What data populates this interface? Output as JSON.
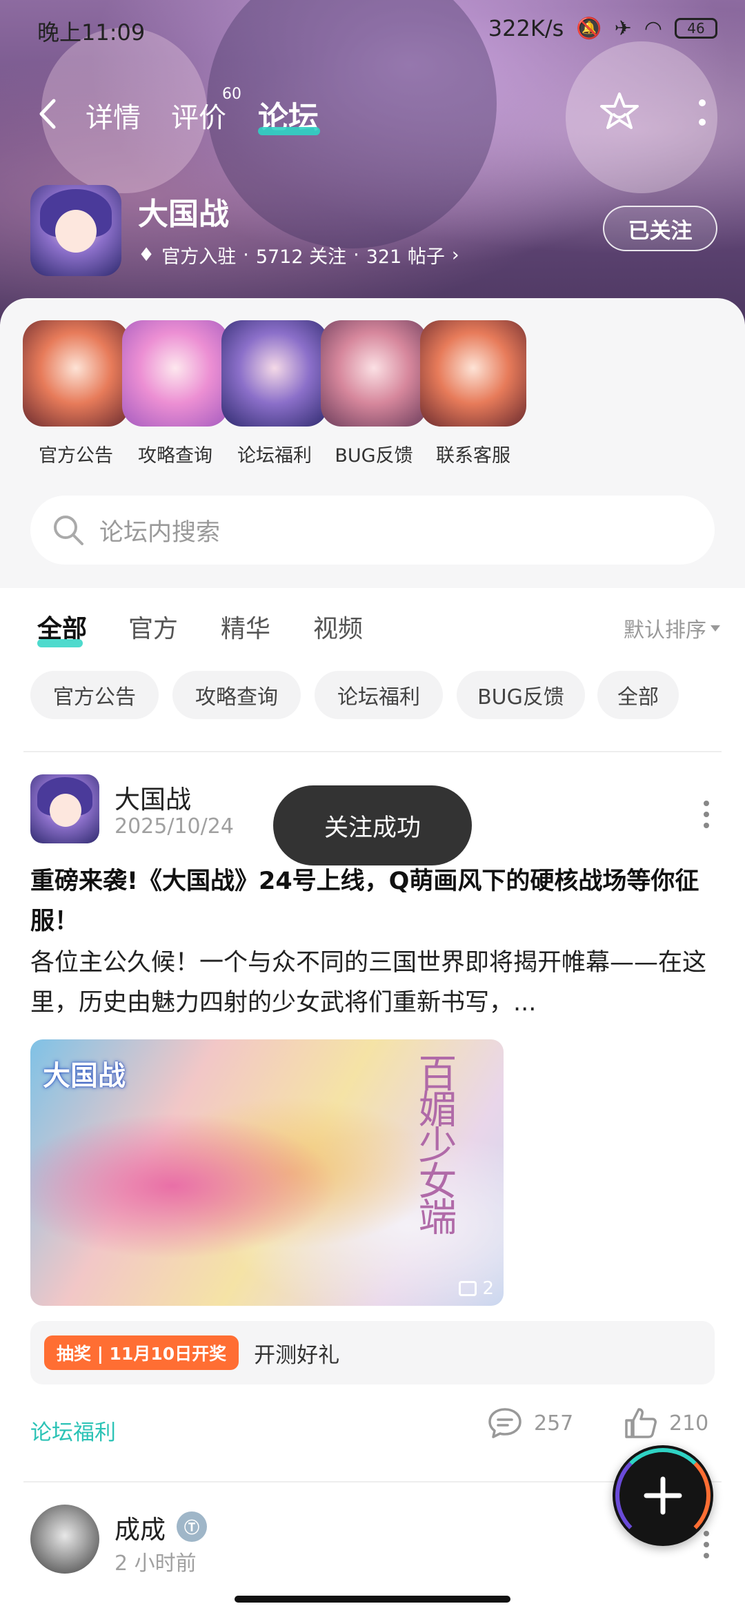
{
  "status_bar": {
    "time": "晚上11:09",
    "speed": "322K/s",
    "battery": "46"
  },
  "nav": {
    "tabs": [
      "详情",
      "评价",
      "论坛"
    ],
    "review_count": "60"
  },
  "game": {
    "name": "大国战",
    "meta_official": "官方入驻",
    "followers": "5712 关注",
    "posts": "321 帖子",
    "follow_label": "已关注"
  },
  "quick_links": [
    "官方公告",
    "攻略查询",
    "论坛福利",
    "BUG反馈",
    "联系客服"
  ],
  "search": {
    "placeholder": "论坛内搜索"
  },
  "feed": {
    "tabs": [
      "全部",
      "官方",
      "精华",
      "视频"
    ],
    "sort_label": "默认排序",
    "chips": [
      "官方公告",
      "攻略查询",
      "论坛福利",
      "BUG反馈",
      "全部"
    ]
  },
  "post": {
    "author": "大国战",
    "date": "2025/10/24",
    "title": "重磅来袭!《大国战》24号上线，Q萌画风下的硬核战场等你征服！",
    "body": "各位主公久候！一个与众不同的三国世界即将揭开帷幕——在这里，历史由魅力四射的少女武将们重新书写，...",
    "image_logo": "大国战",
    "image_side_text": "百媚少女端",
    "image_count": "2",
    "lottery_badge": "抽奖 | 11月10日开奖",
    "lottery_text": "开测好礼",
    "tag": "论坛福利",
    "comments": "257",
    "likes": "210"
  },
  "toast": "关注成功",
  "next_post": {
    "author": "成成",
    "time": "2 小时前"
  },
  "colors": {
    "accent": "#2fd3c4",
    "lottery": "#ff6e33",
    "toast_bg": "#333333"
  }
}
